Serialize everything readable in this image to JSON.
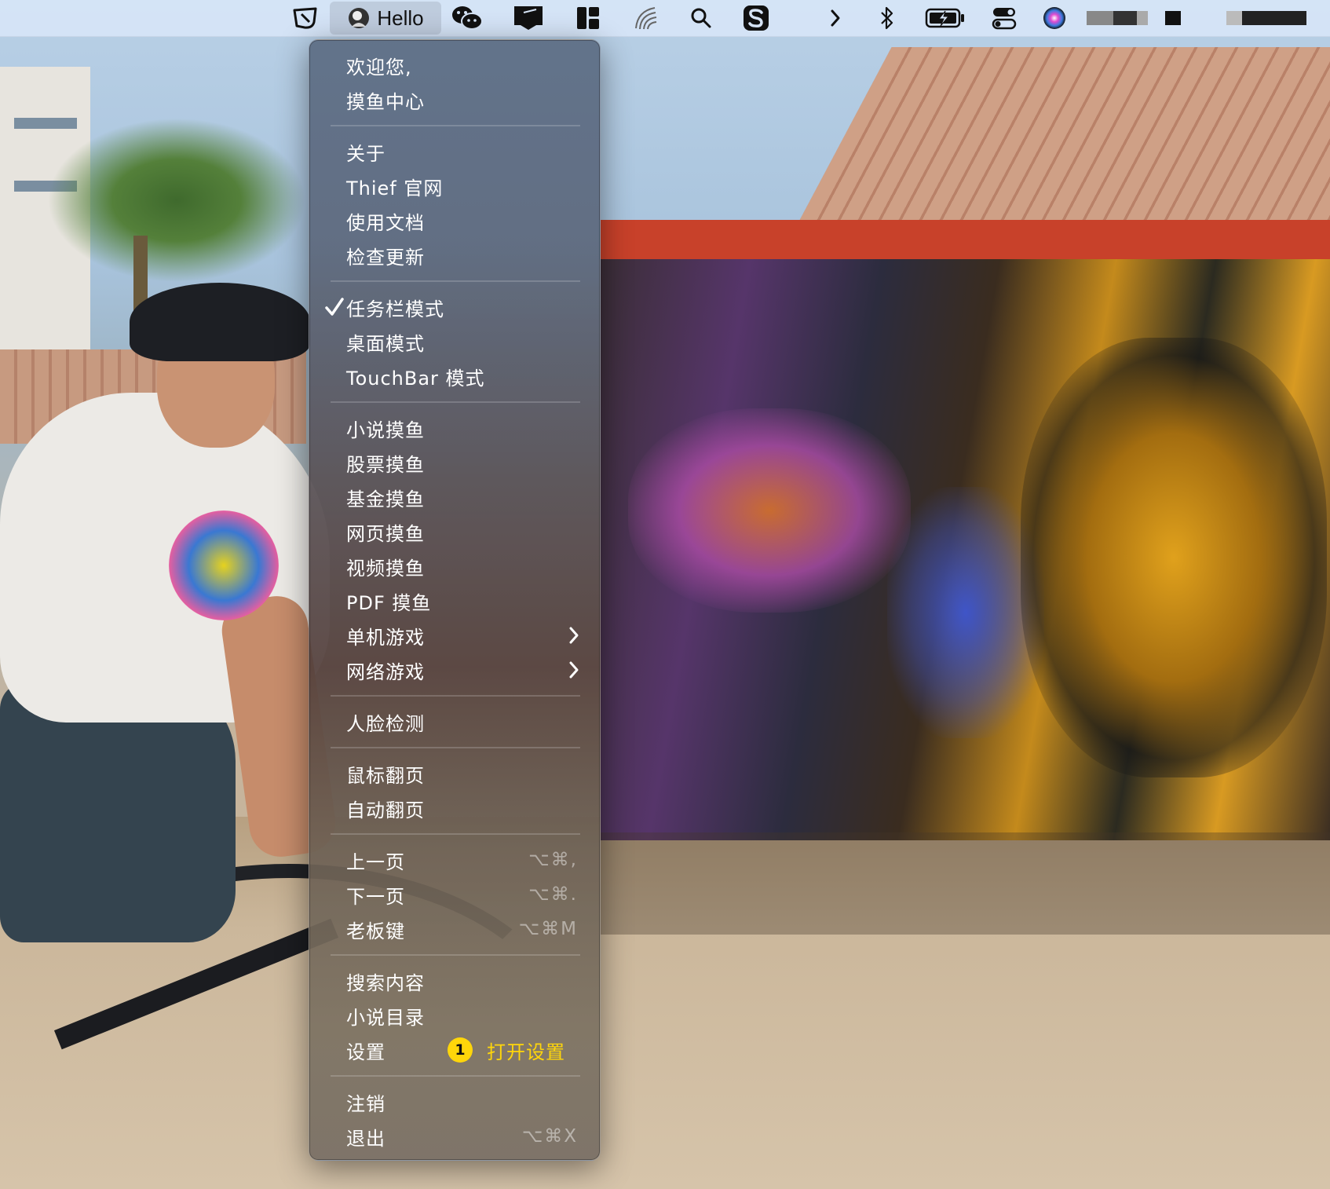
{
  "menubar": {
    "app_title": "Hello",
    "icons": [
      "thief-app-icon",
      "hello-avatar-icon",
      "wechat-icon",
      "display-icon",
      "layout-icon",
      "fingerprint-icon",
      "search-icon",
      "s-app-icon",
      "chevron-right-icon",
      "bluetooth-icon",
      "battery-charging-icon",
      "control-center-icon",
      "siri-icon"
    ]
  },
  "menu": {
    "welcome_line1": "欢迎您,",
    "welcome_line2": "摸鱼中心",
    "about": "关于",
    "website": "Thief 官网",
    "docs": "使用文档",
    "check_update": "检查更新",
    "taskbar_mode": "任务栏模式",
    "taskbar_mode_checked": true,
    "desktop_mode": "桌面模式",
    "touchbar_mode": "TouchBar 模式",
    "novel": "小说摸鱼",
    "stock": "股票摸鱼",
    "fund": "基金摸鱼",
    "web": "网页摸鱼",
    "video": "视频摸鱼",
    "pdf": "PDF 摸鱼",
    "single_game": "单机游戏",
    "online_game": "网络游戏",
    "face_detect": "人脸检测",
    "mouse_flip": "鼠标翻页",
    "auto_flip": "自动翻页",
    "prev_page": "上一页",
    "prev_page_shortcut": "⌥⌘,",
    "next_page": "下一页",
    "next_page_shortcut": "⌥⌘.",
    "boss_key": "老板键",
    "boss_key_shortcut": "⌥⌘M",
    "search_content": "搜索内容",
    "novel_toc": "小说目录",
    "settings": "设置",
    "logout": "注销",
    "quit": "退出",
    "quit_shortcut": "⌥⌘X"
  },
  "annotation": {
    "badge": "1",
    "text": "打开设置",
    "color": "#ffd60a"
  }
}
